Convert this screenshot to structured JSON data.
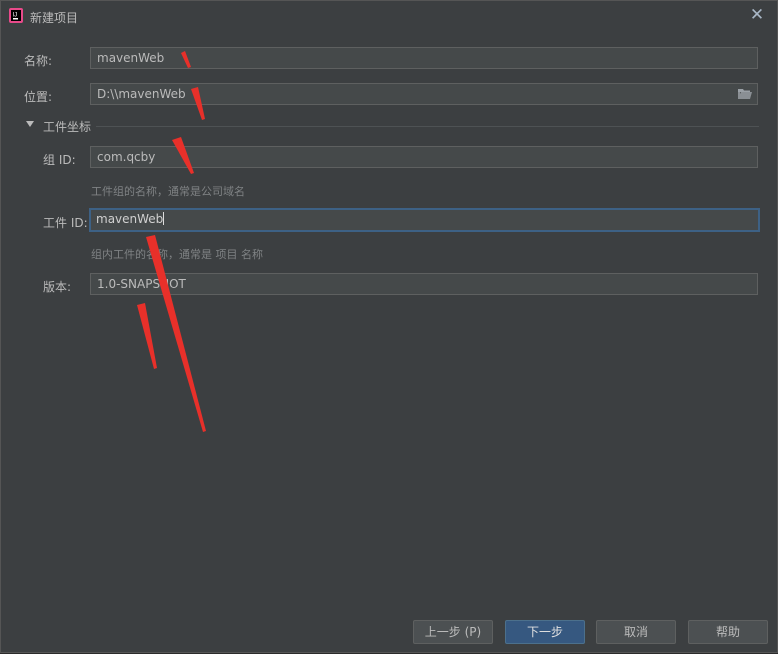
{
  "window": {
    "title": "新建项目",
    "close_symbol": "✕"
  },
  "form": {
    "name_label": "名称:",
    "name_value": "mavenWeb",
    "location_label": "位置:",
    "location_value": "D:\\\\mavenWeb",
    "section_title": "工件坐标",
    "group_label": "组 ID:",
    "group_value": "com.qcby",
    "group_hint": "工件组的名称，通常是公司域名",
    "artifact_label": "工件 ID:",
    "artifact_value": "mavenWeb",
    "artifact_hint": "组内工件的名称，通常是 项目 名称",
    "version_label": "版本:",
    "version_value": "1.0-SNAPSHOT"
  },
  "buttons": {
    "prev": "上一步 (P)",
    "next": "下一步",
    "cancel": "取消",
    "help": "帮助"
  },
  "colors": {
    "background": "#3c3f41",
    "field": "#45494a",
    "focus_border": "#3d6185",
    "primary_button": "#365880",
    "annotation_arrow": "#e8302a"
  },
  "icons": [
    "app-icon",
    "close-icon",
    "folder-icon",
    "collapse-triangle-icon"
  ]
}
